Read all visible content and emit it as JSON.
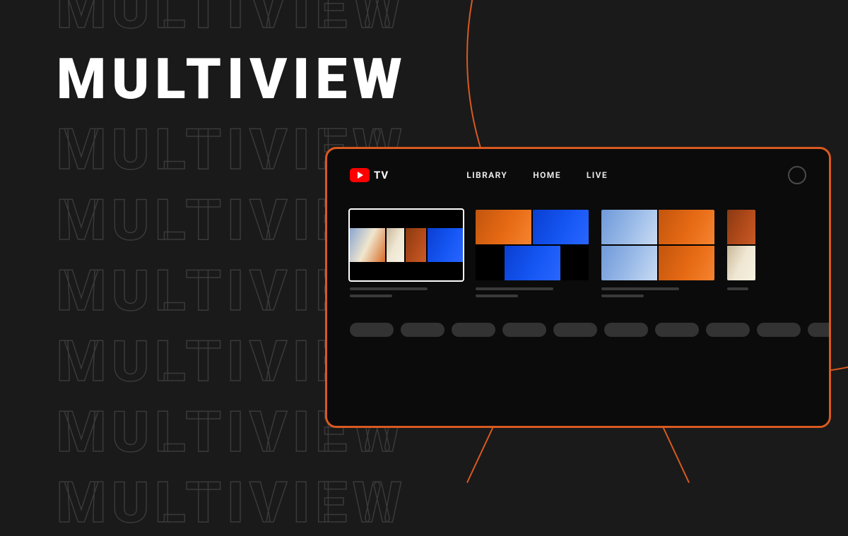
{
  "title": "MULTIVIEW",
  "background_word": "MULTIVIEW",
  "background_repeat": 8,
  "solid_index": 1,
  "tv": {
    "brand": "TV",
    "nav": [
      "LIBRARY",
      "HOME",
      "LIVE"
    ],
    "cards": [
      {
        "layout": "single",
        "selected": true,
        "tiles": [
          "mix1",
          "cream",
          "rust",
          "blue"
        ]
      },
      {
        "layout": "three",
        "selected": false,
        "tiles": [
          "orange",
          "blue",
          "blue"
        ]
      },
      {
        "layout": "quad",
        "selected": false,
        "tiles": [
          "sky",
          "orange",
          "sky",
          "orange"
        ]
      },
      {
        "layout": "peek",
        "selected": false,
        "tiles": [
          "rust",
          "cream"
        ]
      }
    ],
    "pill_count": 10
  },
  "colors": {
    "accent": "#d95920",
    "bg": "#1a1a1a",
    "tv_bg": "#0b0b0b"
  }
}
